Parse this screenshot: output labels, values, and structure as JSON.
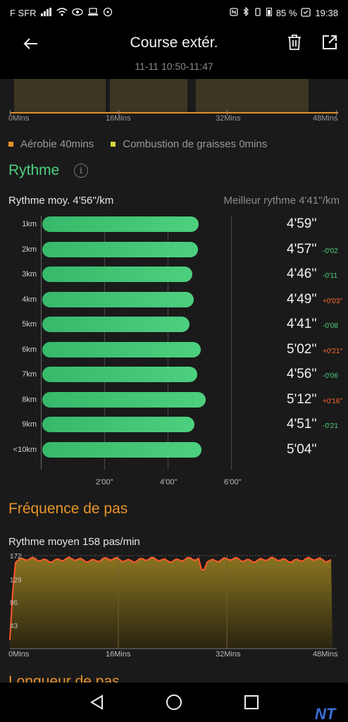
{
  "status_bar": {
    "carrier": "F SFR",
    "battery": "85 %",
    "time": "19:38"
  },
  "header": {
    "title": "Course extér.",
    "subtitle": "11-11 10:50-11:47"
  },
  "zones": {
    "axis_labels": [
      "0Mins",
      "16Mins",
      "32Mins",
      "48Mins"
    ],
    "legend": [
      {
        "label": "Aérobie 40mins",
        "color": "#e8902a"
      },
      {
        "label": "Combustion de graisses 0mins",
        "color": "#d8d23c"
      }
    ]
  },
  "pace": {
    "title": "Rythme",
    "average": "Rythme moy. 4'56''/km",
    "best": "Meilleur rythme 4'41''/km",
    "x_labels": [
      "2'00''",
      "4'00''",
      "6'00''"
    ],
    "accent": "#4cd07e",
    "splits": [
      {
        "km": "1km",
        "pace": "4'59''",
        "seconds": 299,
        "delta": "",
        "delta_color": ""
      },
      {
        "km": "2km",
        "pace": "4'57''",
        "seconds": 297,
        "delta": "-0'02",
        "delta_color": "#4cd07e"
      },
      {
        "km": "3km",
        "pace": "4'46''",
        "seconds": 286,
        "delta": "-0'11",
        "delta_color": "#4cd07e"
      },
      {
        "km": "4km",
        "pace": "4'49''",
        "seconds": 289,
        "delta": "+0'03''",
        "delta_color": "#ff6a2a"
      },
      {
        "km": "5km",
        "pace": "4'41''",
        "seconds": 281,
        "delta": "-0'08",
        "delta_color": "#4cd07e"
      },
      {
        "km": "6km",
        "pace": "5'02''",
        "seconds": 302,
        "delta": "+0'21''",
        "delta_color": "#ff6a2a"
      },
      {
        "km": "7km",
        "pace": "4'56''",
        "seconds": 296,
        "delta": "-0'06",
        "delta_color": "#4cd07e"
      },
      {
        "km": "8km",
        "pace": "5'12''",
        "seconds": 312,
        "delta": "+0'16''",
        "delta_color": "#ff6a2a"
      },
      {
        "km": "9km",
        "pace": "4'51''",
        "seconds": 291,
        "delta": "-0'21",
        "delta_color": "#4cd07e"
      },
      {
        "km": "<10km",
        "pace": "5'04''",
        "seconds": 304,
        "delta": "",
        "delta_color": ""
      }
    ]
  },
  "cadence": {
    "title": "Fréquence de pas",
    "average": "Rythme moyen 158 pas/min",
    "y_labels": [
      "172",
      "129",
      "86",
      "43"
    ],
    "x_labels": [
      "0Mins",
      "16Mins",
      "32Mins",
      "48Mins"
    ],
    "accent": "#e8942a"
  },
  "next_section": {
    "title": "Longueur de pas"
  },
  "watermark": "NT"
}
